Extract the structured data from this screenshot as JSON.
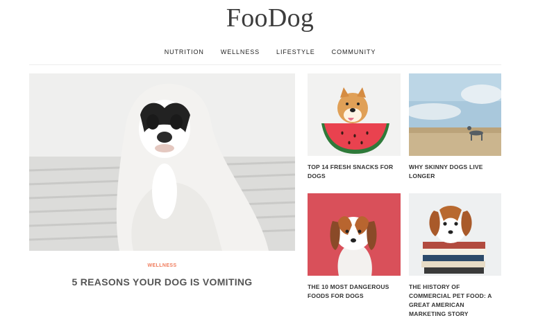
{
  "site": {
    "logo": "FooDog"
  },
  "nav": {
    "items": [
      {
        "label": "NUTRITION"
      },
      {
        "label": "WELLNESS"
      },
      {
        "label": "LIFESTYLE"
      },
      {
        "label": "COMMUNITY"
      }
    ]
  },
  "featured": {
    "category": "WELLNESS",
    "title": "5 REASONS YOUR DOG IS VOMITING"
  },
  "articles": [
    {
      "title": "TOP 14 FRESH SNACKS FOR DOGS"
    },
    {
      "title": "WHY SKINNY DOGS LIVE LONGER"
    },
    {
      "title": "THE 10 MOST DANGEROUS FOODS FOR DOGS"
    },
    {
      "title": "THE HISTORY OF COMMERCIAL PET FOOD: A GREAT AMERICAN MARKETING STORY"
    }
  ],
  "colors": {
    "accent": "#f07a5a",
    "card_red": "#d9505a"
  }
}
